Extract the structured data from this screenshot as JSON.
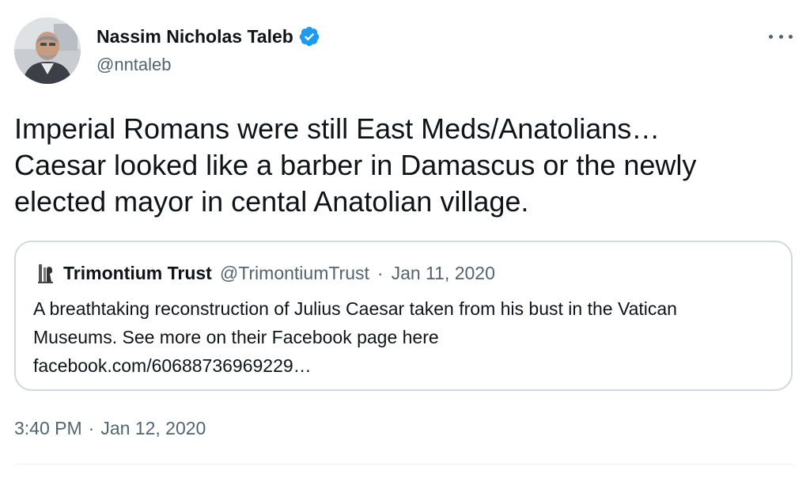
{
  "author": {
    "name": "Nassim Nicholas Taleb",
    "handle": "@nntaleb",
    "verified": true
  },
  "tweet": {
    "text": "Imperial Romans were still East Meds/Anatolians…\nCaesar looked like a barber in Damascus or the newly\nelected mayor in cental Anatolian village."
  },
  "quoted": {
    "name": "Trimontium Trust",
    "handle": "@TrimontiumTrust",
    "separator": "·",
    "date": "Jan 11, 2020",
    "text_line1": "A breathtaking reconstruction of Julius Caesar taken from his bust in the Vatican",
    "text_line2": "Museums. See more on their Facebook page here",
    "link": "facebook.com/60688736969229…"
  },
  "meta": {
    "time": "3:40 PM",
    "separator": "·",
    "date": "Jan 12, 2020"
  },
  "colors": {
    "verified": "#1d9bf0",
    "secondary_text": "#536471",
    "border": "#cfd9de"
  },
  "icons": {
    "verified": "verified-badge-icon",
    "more": "more-options-icon"
  }
}
